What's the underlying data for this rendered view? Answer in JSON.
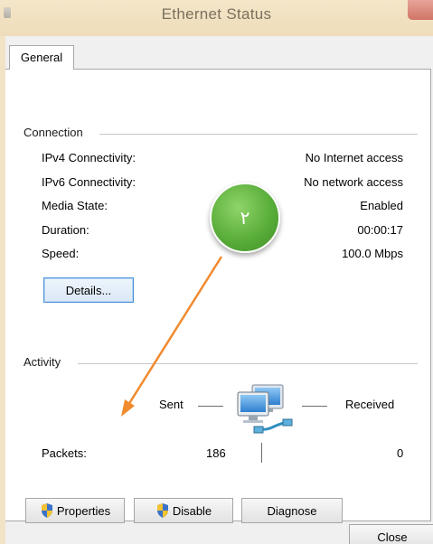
{
  "window": {
    "title": "Ethernet Status"
  },
  "tabs": [
    {
      "label": "General"
    }
  ],
  "connection": {
    "group_label": "Connection",
    "rows": [
      {
        "label": "IPv4 Connectivity:",
        "value": "No Internet access"
      },
      {
        "label": "IPv6 Connectivity:",
        "value": "No network access"
      },
      {
        "label": "Media State:",
        "value": "Enabled"
      },
      {
        "label": "Duration:",
        "value": "00:00:17"
      },
      {
        "label": "Speed:",
        "value": "100.0 Mbps"
      }
    ],
    "details_label": "Details..."
  },
  "activity": {
    "group_label": "Activity",
    "sent_label": "Sent",
    "received_label": "Received",
    "packets_label": "Packets:",
    "packets_sent": "186",
    "packets_received": "0"
  },
  "buttons": {
    "properties": "Properties",
    "disable": "Disable",
    "diagnose": "Diagnose",
    "close": "Close"
  },
  "annotation": {
    "badge_text": "٢",
    "color": "#f08a2e"
  },
  "icons": [
    "shield-icon",
    "network-computers-icon",
    "window-icon"
  ],
  "colors": {
    "title_bar": "#f2e3c6",
    "accent_focus": "#4a90d9",
    "badge_green": "#5aae3a"
  }
}
